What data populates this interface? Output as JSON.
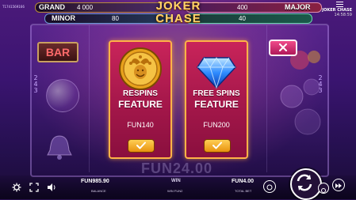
{
  "game_id": "T1741569166",
  "top_right": {
    "game_name": "JOKER CHASE",
    "clock": "14:58:59"
  },
  "logo": {
    "line1": "JOKER",
    "line2": "CHASE"
  },
  "jackpots": {
    "grand": {
      "label": "GRAND",
      "value": "4 000"
    },
    "minor": {
      "label": "MINOR",
      "value": "80"
    },
    "major": {
      "label": "MAJOR",
      "value": "400"
    },
    "mini": {
      "label": "",
      "value": "40"
    }
  },
  "reel_symbol": {
    "bar": "BAR"
  },
  "side_numbers": [
    "2",
    "4",
    "3"
  ],
  "features": [
    {
      "title_line1": "RESPINS",
      "title_line2": "FEATURE",
      "price": "FUN140",
      "icon": "jester-coin-icon"
    },
    {
      "title_line1": "FREE SPINS",
      "title_line2": "FEATURE",
      "price": "FUN200",
      "icon": "diamond-icon"
    }
  ],
  "win_display": "FUN24.00",
  "bottom_bar": {
    "balance_value": "FUN985.90",
    "balance_label": "BALANCE",
    "win_title": "WIN",
    "win_value": "WIN FUN2",
    "total_bet_value": "FUN4.00",
    "total_bet_label": "TOTAL BET"
  },
  "colors": {
    "card": "#b01a52",
    "card_border": "#ffb347",
    "select": "#f2a820",
    "close": "#e0387a"
  }
}
